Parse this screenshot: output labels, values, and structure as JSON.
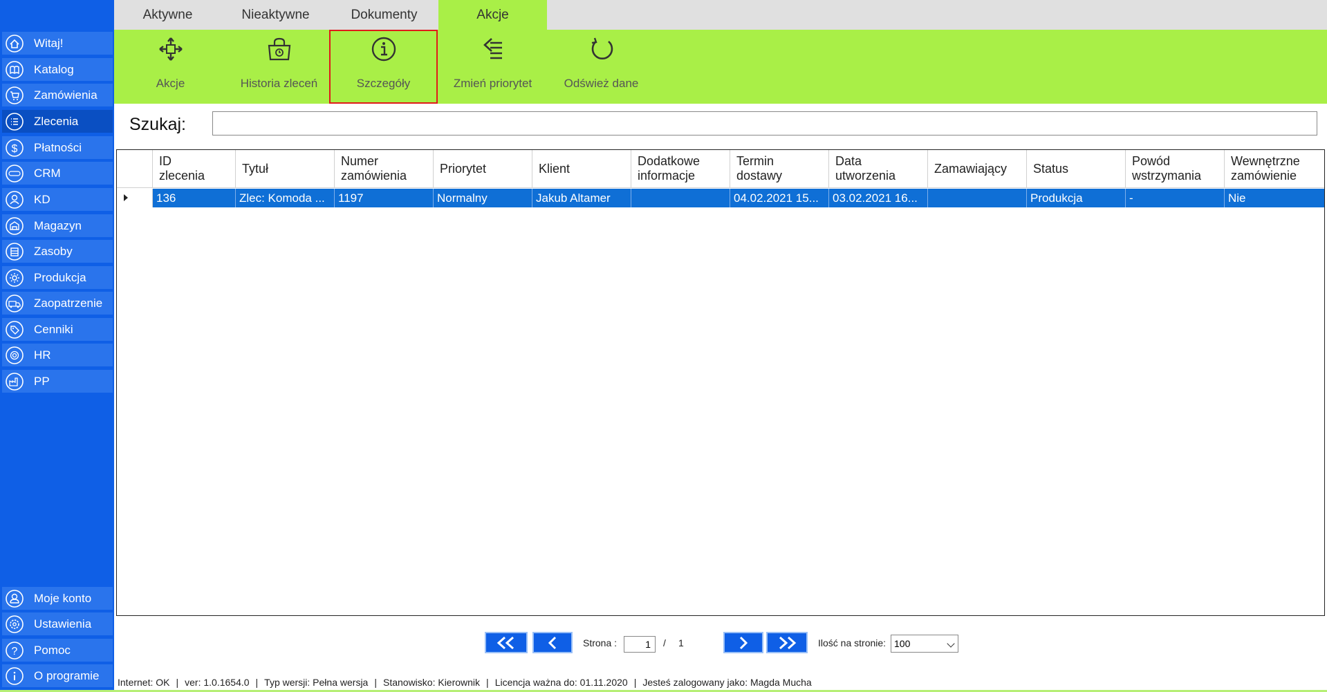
{
  "sidebar": {
    "items": [
      {
        "label": "Witaj!",
        "icon": "home-icon"
      },
      {
        "label": "Katalog",
        "icon": "book-icon"
      },
      {
        "label": "Zamówienia",
        "icon": "cart-icon"
      },
      {
        "label": "Zlecenia",
        "icon": "list-icon"
      },
      {
        "label": "Płatności",
        "icon": "dollar-icon"
      },
      {
        "label": "CRM",
        "icon": "crm-icon"
      },
      {
        "label": "KD",
        "icon": "user-icon"
      },
      {
        "label": "Magazyn",
        "icon": "warehouse-icon"
      },
      {
        "label": "Zasoby",
        "icon": "resources-icon"
      },
      {
        "label": "Produkcja",
        "icon": "gear-icon"
      },
      {
        "label": "Zaopatrzenie",
        "icon": "truck-icon"
      },
      {
        "label": "Cenniki",
        "icon": "tag-icon"
      },
      {
        "label": "HR",
        "icon": "fingerprint-icon"
      },
      {
        "label": "PP",
        "icon": "factory-icon"
      }
    ],
    "bottom_items": [
      {
        "label": "Moje konto",
        "icon": "account-icon"
      },
      {
        "label": "Ustawienia",
        "icon": "settings-icon"
      },
      {
        "label": "Pomoc",
        "icon": "help-icon"
      },
      {
        "label": "O programie",
        "icon": "info-icon"
      }
    ],
    "active": "Zlecenia"
  },
  "tabs": [
    {
      "label": "Aktywne"
    },
    {
      "label": "Nieaktywne"
    },
    {
      "label": "Dokumenty"
    },
    {
      "label": "Akcje"
    }
  ],
  "active_tab": "Akcje",
  "ribbon": [
    {
      "label": "Akcje",
      "icon": "move-arrows-icon"
    },
    {
      "label": "Historia zleceń",
      "icon": "history-bag-icon"
    },
    {
      "label": "Szczegóły",
      "icon": "info-circle-icon"
    },
    {
      "label": "Zmień priorytet",
      "icon": "priority-icon"
    },
    {
      "label": "Odśwież dane",
      "icon": "refresh-icon"
    }
  ],
  "selected_ribbon": "Szczegóły",
  "search": {
    "label": "Szukaj:",
    "value": "",
    "placeholder": ""
  },
  "grid": {
    "headers": [
      [
        "ID",
        "zlecenia"
      ],
      [
        "Tytuł",
        ""
      ],
      [
        "Numer",
        "zamówienia"
      ],
      [
        "Priorytet",
        ""
      ],
      [
        "Klient",
        ""
      ],
      [
        "Dodatkowe",
        "informacje"
      ],
      [
        "Termin",
        "dostawy"
      ],
      [
        "Data",
        "utworzenia"
      ],
      [
        "Zamawiający",
        ""
      ],
      [
        "Status",
        ""
      ],
      [
        "Powód",
        "wstrzymania"
      ],
      [
        "Wewnętrzne",
        "zamówienie"
      ]
    ],
    "rows": [
      [
        "136",
        "Zlec: Komoda ...",
        "1197",
        "Normalny",
        "Jakub  Altamer",
        "",
        "04.02.2021 15...",
        "03.02.2021 16...",
        "",
        "Produkcja",
        "-",
        "Nie"
      ]
    ]
  },
  "pager": {
    "page_label": "Strona :",
    "current_page": "1",
    "separator": "/",
    "total_pages": "1",
    "per_page_label": "Ilość na stronie:",
    "per_page_value": "100"
  },
  "status": {
    "internet": "Internet: OK",
    "version": "ver: 1.0.1654.0",
    "type": "Typ wersji: Pełna wersja",
    "station": "Stanowisko: Kierownik",
    "license": "Licencja ważna do: 01.11.2020",
    "user": "Jesteś zalogowany jako: Magda Mucha"
  },
  "colors": {
    "sidebar": "#0f5fe6",
    "sidebar_item": "#2a74ec",
    "ribbon": "#a9ef47",
    "selected_row": "#0f6fd6",
    "highlight_border": "#e01a1a"
  }
}
